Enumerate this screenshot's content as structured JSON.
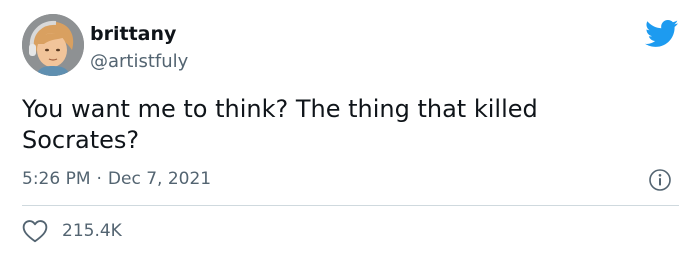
{
  "author": {
    "display_name": "brittany",
    "handle": "@artistfuly",
    "avatar_icon": "illustrated-portrait-avatar"
  },
  "tweet": {
    "text": "You want me to think? The thing that killed Socrates?",
    "time": "5:26 PM",
    "separator": "·",
    "date": "Dec 7, 2021"
  },
  "engagement": {
    "likes": "215.4K",
    "like_icon": "heart-icon"
  },
  "icons": {
    "brand": "twitter-bird-icon",
    "info": "info-icon"
  },
  "colors": {
    "brand_blue": "#1d9bf0",
    "text_primary": "#0f1419",
    "text_secondary": "#536471",
    "divider": "#cfd9de"
  }
}
